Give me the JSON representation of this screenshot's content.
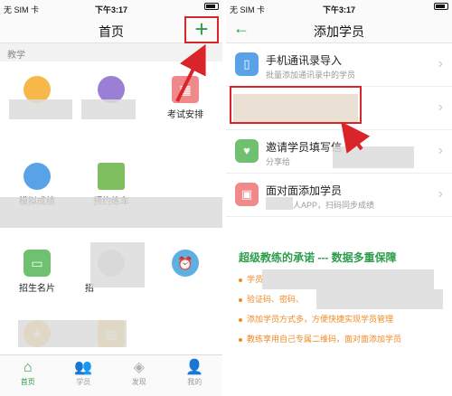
{
  "status": {
    "carrier": "无 SIM 卡",
    "time": "下午3:17"
  },
  "left": {
    "title": "首页",
    "plus": "+",
    "section": "教学",
    "cells": [
      "",
      "",
      "考试安排",
      "模拟成绩",
      "预约练车",
      "",
      "招生名片",
      "招",
      ""
    ],
    "tabs": [
      {
        "label": "首页",
        "icon": "⌂"
      },
      {
        "label": "学员",
        "icon": "👥"
      },
      {
        "label": "发现",
        "icon": "◈"
      },
      {
        "label": "我的",
        "icon": "👤"
      }
    ]
  },
  "right": {
    "title": "添加学员",
    "back": "←",
    "rows": [
      {
        "title": "手机通讯录导入",
        "sub": "批量添加通讯录中的学员"
      },
      {
        "title": "",
        "sub": ""
      },
      {
        "title": "邀请学员填写信",
        "sub": "分享给"
      },
      {
        "title": "面对面添加学员",
        "sub": "人APP，扫码同步成绩"
      }
    ],
    "promise": "超级教练的承诺 --- 数据多重保障",
    "bullets": [
      "学员",
      "验证码、密码、",
      "添加学员方式多，方便快捷实现学员管理",
      "教练享用自己专属二维码，面对面添加学员"
    ]
  },
  "colors": {
    "accent": "#2c9d4a",
    "highlight": "#d9252a",
    "bullet": "#f08a24"
  }
}
